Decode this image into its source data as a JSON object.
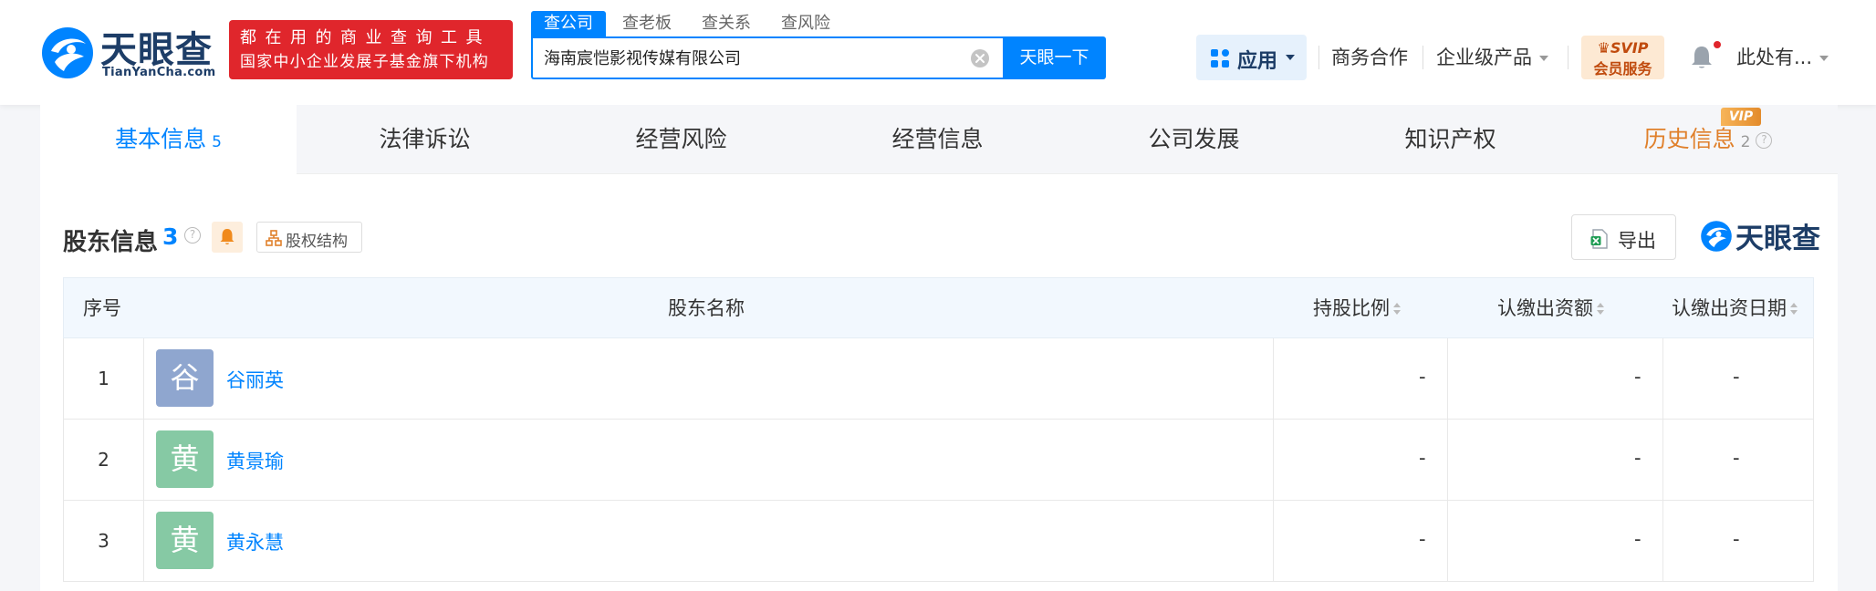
{
  "header": {
    "logo_name": "天眼查",
    "logo_domain": "TianYanCha.com",
    "slogan_line1": "都在用的商业查询工具",
    "slogan_line2": "国家中小企业发展子基金旗下机构",
    "search_tabs": [
      "查公司",
      "查老板",
      "查关系",
      "查风险"
    ],
    "search_value": "海南宸恺影视传媒有限公司",
    "search_button": "天眼一下",
    "app_label": "应用",
    "nav_business": "商务合作",
    "nav_enterprise": "企业级产品",
    "svip_top": "SVIP",
    "svip_bottom": "会员服务",
    "user_name": "此处有..."
  },
  "tabs": [
    {
      "label": "基本信息",
      "count": "5"
    },
    {
      "label": "法律诉讼"
    },
    {
      "label": "经营风险"
    },
    {
      "label": "经营信息"
    },
    {
      "label": "公司发展"
    },
    {
      "label": "知识产权"
    },
    {
      "label": "历史信息",
      "count": "2",
      "badge": "VIP"
    }
  ],
  "section": {
    "title": "股东信息",
    "count": "3",
    "structure_button": "股权结构",
    "export_button": "导出",
    "brand": "天眼查"
  },
  "table": {
    "columns": [
      "序号",
      "股东名称",
      "持股比例",
      "认缴出资额",
      "认缴出资日期"
    ],
    "rows": [
      {
        "index": "1",
        "avatar": "谷",
        "name": "谷丽英",
        "ratio": "-",
        "amount": "-",
        "date": "-",
        "avatar_color": "#8fa6cf"
      },
      {
        "index": "2",
        "avatar": "黄",
        "name": "黄景瑜",
        "ratio": "-",
        "amount": "-",
        "date": "-",
        "avatar_color": "#86c9a4"
      },
      {
        "index": "3",
        "avatar": "黄",
        "name": "黄永慧",
        "ratio": "-",
        "amount": "-",
        "date": "-",
        "avatar_color": "#86c9a4"
      }
    ]
  },
  "colors": {
    "brand_blue": "#0084ff",
    "logo_navy": "#1d3d67",
    "slogan_red": "#e0262c",
    "vip_orange": "#e0802b"
  }
}
